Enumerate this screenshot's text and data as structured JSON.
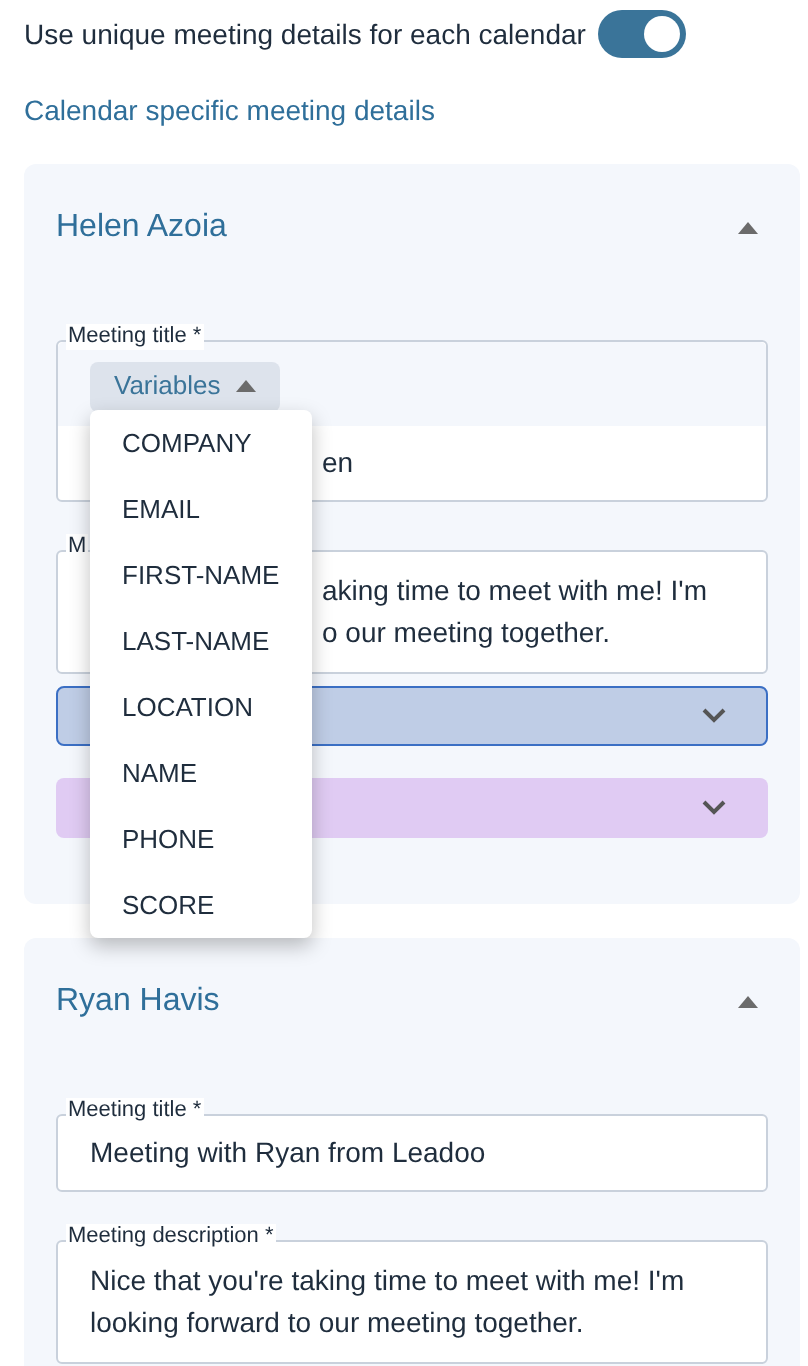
{
  "toggle": {
    "label": "Use unique meeting details for each calendar",
    "on": true
  },
  "section_title": "Calendar specific meeting details",
  "calendars": [
    {
      "name": "Helen Azoia",
      "expanded": true,
      "title_field": {
        "label": "Meeting title *",
        "value": "en"
      },
      "variables_button": {
        "label": "Variables",
        "expanded": true
      },
      "description_field": {
        "label": "M",
        "value": "aking time to meet with me! I'm\no our meeting together."
      },
      "selects": [
        {
          "kind": "focused",
          "color": "#bfcde6"
        },
        {
          "kind": "plain",
          "color": "#e0cbf3"
        }
      ]
    },
    {
      "name": "Ryan Havis",
      "expanded": true,
      "title_field": {
        "label": "Meeting title *",
        "value": "Meeting with Ryan from Leadoo"
      },
      "description_field": {
        "label": "Meeting description *",
        "value": "Nice that you're taking time to meet with me! I'm\nlooking forward to our meeting together."
      }
    }
  ],
  "variables_menu": {
    "items": [
      "COMPANY",
      "EMAIL",
      "FIRST-NAME",
      "LAST-NAME",
      "LOCATION",
      "NAME",
      "PHONE",
      "SCORE"
    ]
  }
}
